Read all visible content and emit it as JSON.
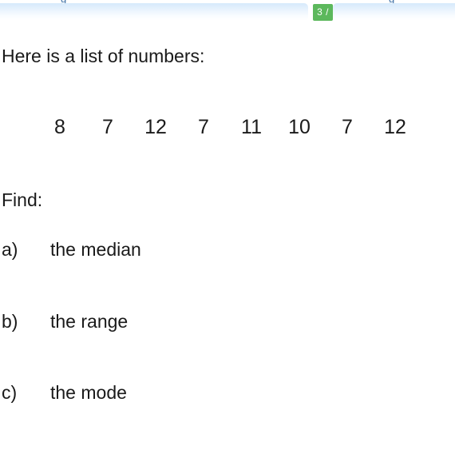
{
  "toolbar": {
    "score_badge": "3 /",
    "badge_color": "#5cb85c",
    "panel_color": "#d6e9fb",
    "left_glyph_fragment": "g",
    "right_glyph_fragment": "g"
  },
  "worksheet": {
    "intro": "Here is a list of numbers:",
    "numbers": [
      "8",
      "7",
      "12",
      "7",
      "11",
      "10",
      "7",
      "12"
    ],
    "find_label": "Find:",
    "questions": [
      {
        "marker": "a)",
        "text": "the median"
      },
      {
        "marker": "b)",
        "text": "the range"
      },
      {
        "marker": "c)",
        "text": "the mode"
      }
    ]
  }
}
